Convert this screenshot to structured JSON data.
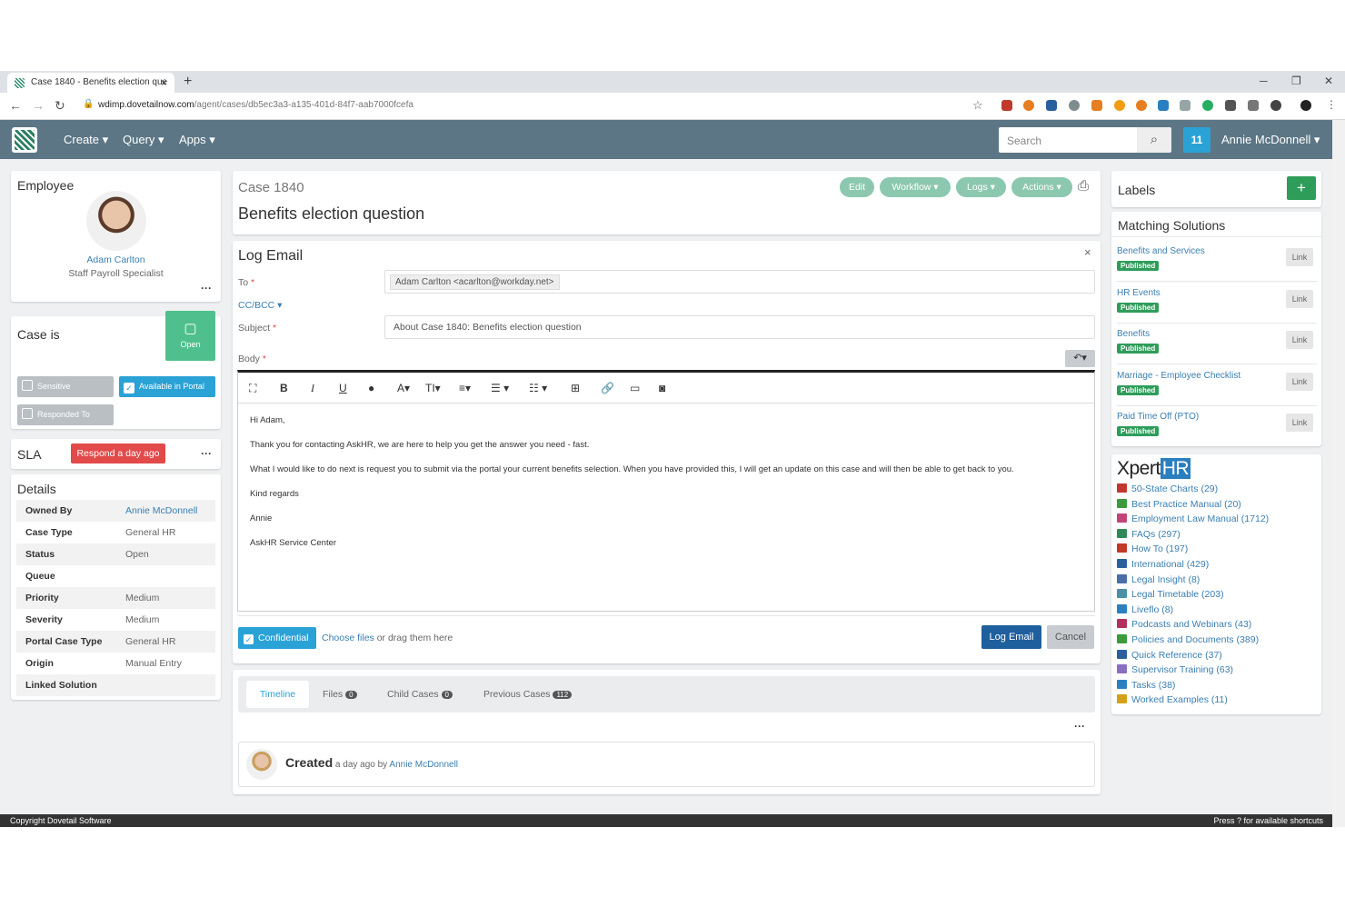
{
  "browser": {
    "tab_title": "Case 1840 - Benefits election que",
    "url_host": "wdimp.dovetailnow.com",
    "url_path": "/agent/cases/db5ec3a3-a135-401d-84f7-aab7000fcefa"
  },
  "nav": {
    "create": "Create",
    "query": "Query",
    "apps": "Apps",
    "search_placeholder": "Search",
    "notif_count": "11",
    "user": "Annie McDonnell"
  },
  "employee": {
    "heading": "Employee",
    "name": "Adam Carlton",
    "title": "Staff Payroll Specialist"
  },
  "case_status": {
    "heading": "Case is",
    "state": "Open",
    "sensitive": "Sensitive",
    "available": "Available in Portal",
    "responded": "Responded To"
  },
  "sla": {
    "heading": "SLA",
    "badge": "Respond a day ago"
  },
  "details": {
    "heading": "Details",
    "rows": [
      {
        "label": "Owned By",
        "value": "Annie McDonnell"
      },
      {
        "label": "Case Type",
        "value": "General HR"
      },
      {
        "label": "Status",
        "value": "Open"
      },
      {
        "label": "Queue",
        "value": ""
      },
      {
        "label": "Priority",
        "value": "Medium"
      },
      {
        "label": "Severity",
        "value": "Medium"
      },
      {
        "label": "Portal Case Type",
        "value": "General HR"
      },
      {
        "label": "Origin",
        "value": "Manual Entry"
      },
      {
        "label": "Linked Solution",
        "value": ""
      }
    ]
  },
  "case": {
    "number": "Case 1840",
    "title": "Benefits election question",
    "edit": "Edit",
    "workflow": "Workflow",
    "logs": "Logs",
    "actions": "Actions"
  },
  "email": {
    "heading": "Log Email",
    "to_label": "To",
    "to_value": "Adam Carlton <acarlton@workday.net>",
    "ccbcc": "CC/BCC",
    "subject_label": "Subject",
    "subject_value": "About Case 1840: Benefits election question",
    "body_label": "Body",
    "body_lines": [
      "Hi Adam,",
      "Thank you for contacting AskHR, we are here to help you get the answer you need - fast.",
      "What I would like to do next is request you to submit via the portal your current benefits selection. When you have provided this, I will get an update on this case and will then be able to get back to you.",
      "Kind regards",
      "Annie",
      "AskHR Service Center"
    ],
    "confidential": "Confidential",
    "choose_files": "Choose files",
    "drag_text": " or drag them here",
    "log_btn": "Log Email",
    "cancel_btn": "Cancel"
  },
  "tabs": [
    {
      "label": "Timeline",
      "count": ""
    },
    {
      "label": "Files",
      "count": "0"
    },
    {
      "label": "Child Cases",
      "count": "0"
    },
    {
      "label": "Previous Cases",
      "count": "112"
    }
  ],
  "timeline": {
    "created": "Created",
    "meta": " a day ago by ",
    "by": "Annie McDonnell"
  },
  "labels": {
    "heading": "Labels"
  },
  "solutions": {
    "heading": "Matching Solutions",
    "status": "Published",
    "link": "Link",
    "items": [
      "Benefits and Services",
      "HR Events",
      "Benefits",
      "Marriage - Employee Checklist",
      "Paid Time Off (PTO)"
    ]
  },
  "xperthr": {
    "brand1": "Xpert",
    "brand2": "HR",
    "items": [
      {
        "label": "50-State Charts (29)",
        "color": "#c0392b"
      },
      {
        "label": "Best Practice Manual (20)",
        "color": "#3a9b3a"
      },
      {
        "label": "Employment Law Manual (1712)",
        "color": "#c2457a"
      },
      {
        "label": "FAQs (297)",
        "color": "#2e8b57"
      },
      {
        "label": "How To (197)",
        "color": "#c0392b"
      },
      {
        "label": "International (429)",
        "color": "#2a5f9e"
      },
      {
        "label": "Legal Insight (8)",
        "color": "#4a6fa5"
      },
      {
        "label": "Legal Timetable (203)",
        "color": "#4a8fa5"
      },
      {
        "label": "Liveflo (8)",
        "color": "#2a7fc0"
      },
      {
        "label": "Podcasts and Webinars (43)",
        "color": "#b03060"
      },
      {
        "label": "Policies and Documents (389)",
        "color": "#3a9b3a"
      },
      {
        "label": "Quick Reference (37)",
        "color": "#2a5f9e"
      },
      {
        "label": "Supervisor Training (63)",
        "color": "#8a6fc0"
      },
      {
        "label": "Tasks (38)",
        "color": "#2a7fc0"
      },
      {
        "label": "Worked Examples (11)",
        "color": "#d4a017"
      }
    ]
  },
  "footer": {
    "left": "Copyright Dovetail Software",
    "right": "Press ? for available shortcuts"
  }
}
